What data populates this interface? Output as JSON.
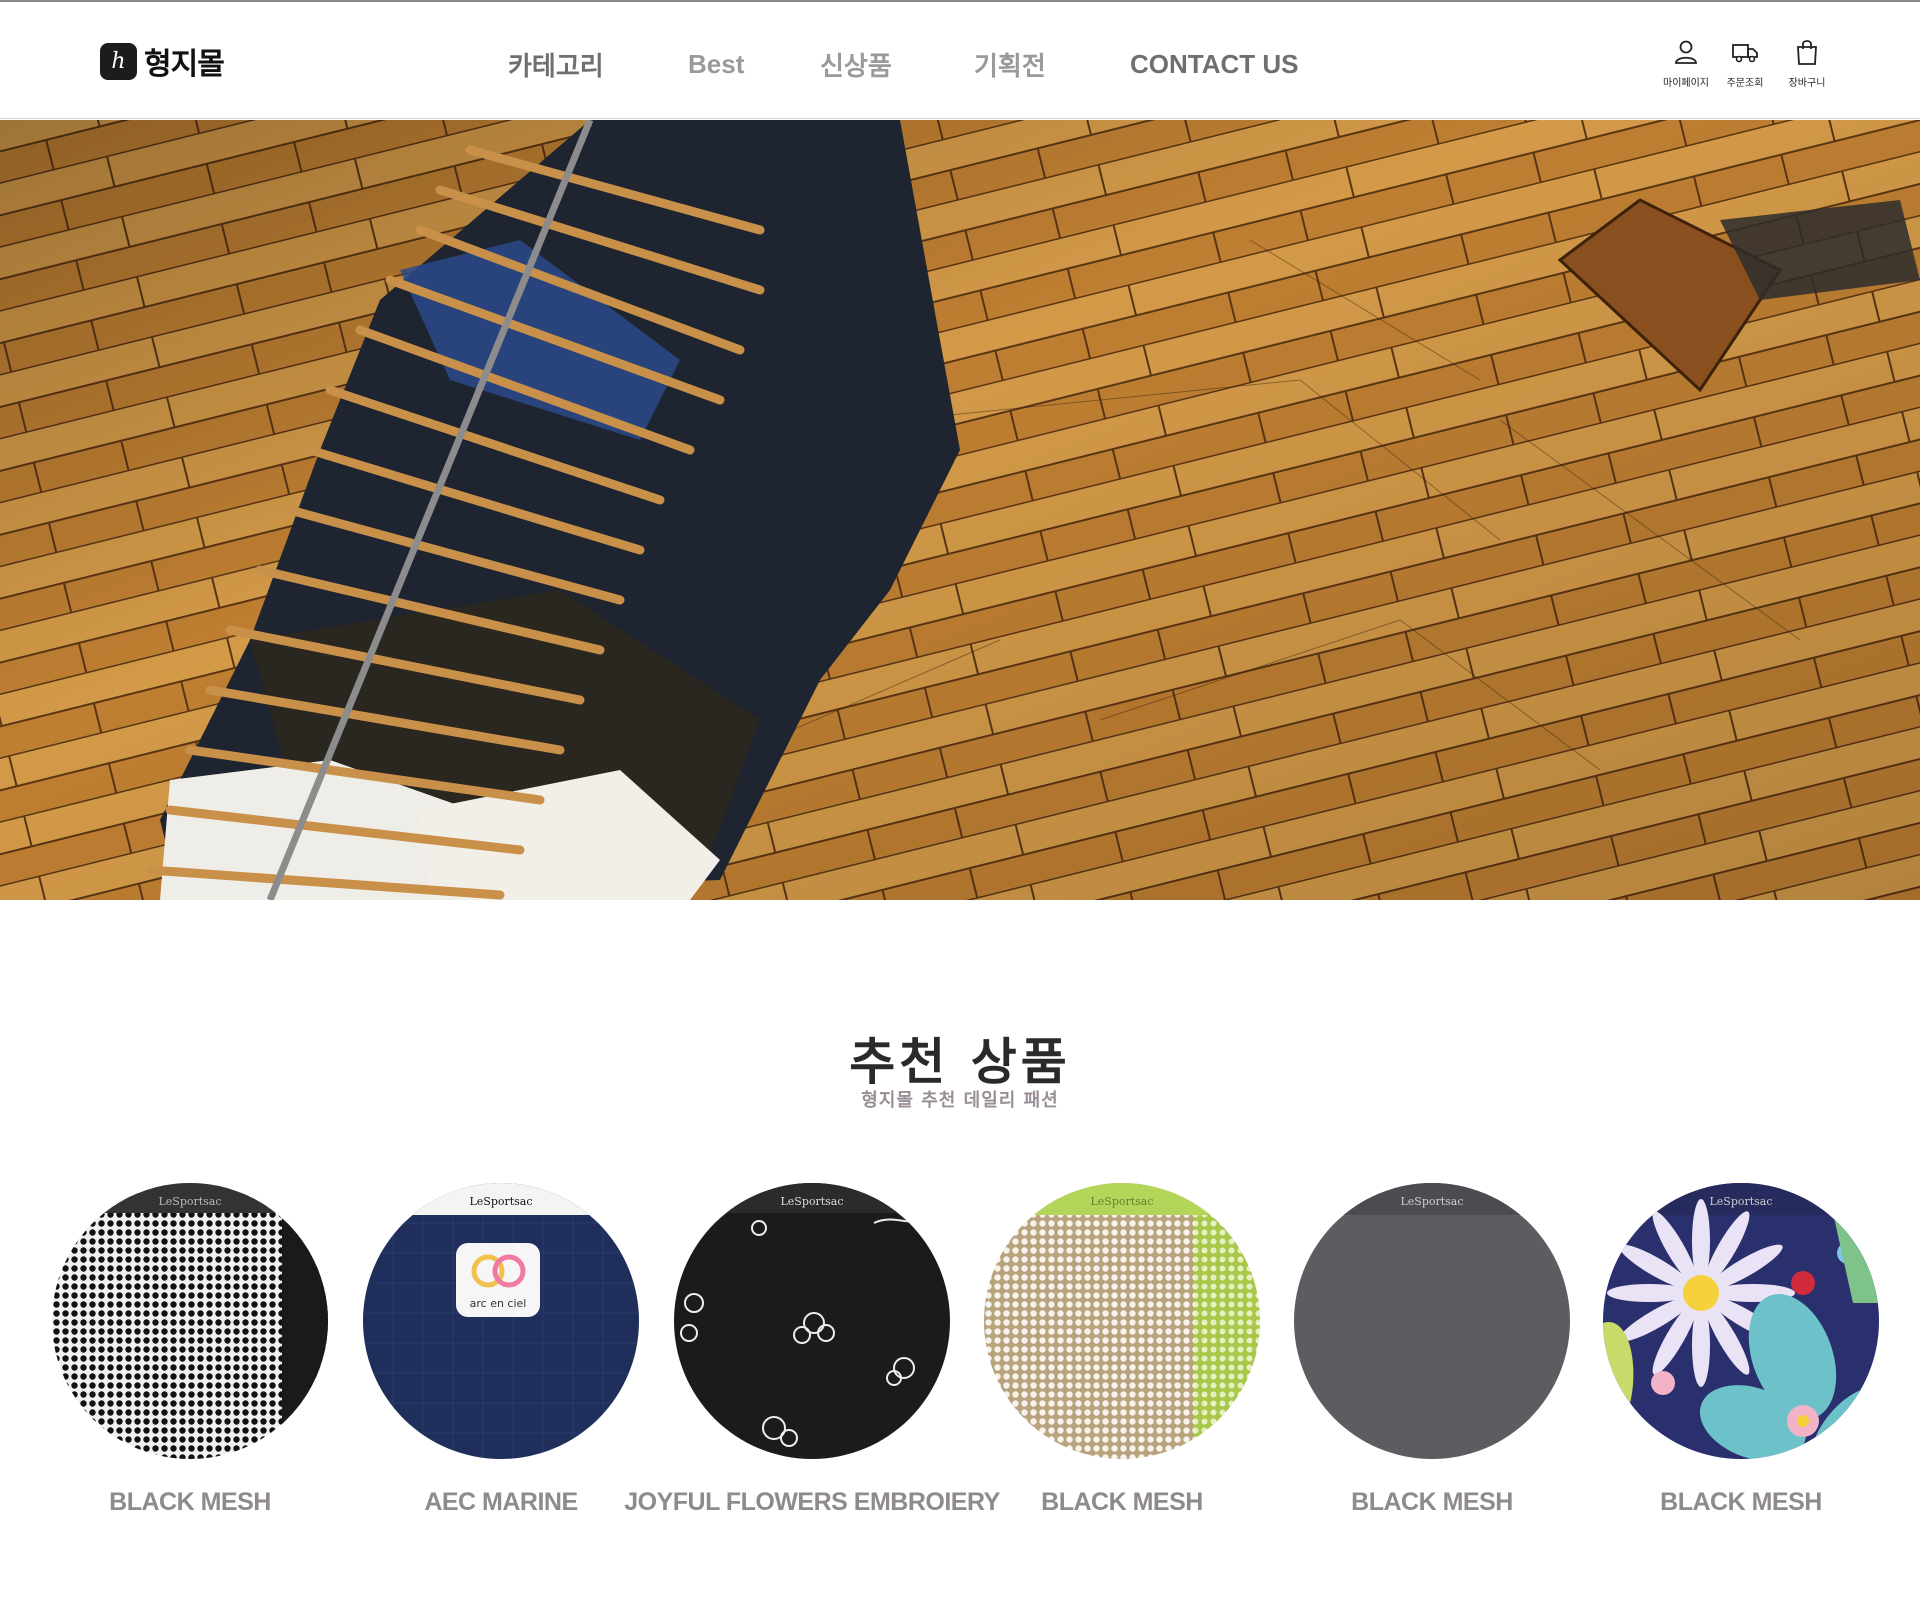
{
  "header": {
    "logo_mark": "h",
    "logo_text": "형지몰",
    "nav": [
      "카테고리",
      "Best",
      "신상품",
      "기획전",
      "CONTACT US"
    ],
    "utilities": [
      {
        "label": "마이페이지",
        "icon": "user-icon"
      },
      {
        "label": "주문조회",
        "icon": "truck-icon"
      },
      {
        "label": "장바구니",
        "icon": "shopping-bag-icon"
      }
    ]
  },
  "hero": {
    "image": "clothes-rack-on-wooden-floor"
  },
  "recommended": {
    "title": "추천 상품",
    "subtitle": "형지몰 추천 데일리 패션",
    "products": [
      {
        "name": "BLACK MESH",
        "brand": "LeSportsac",
        "swatch": "black-mesh"
      },
      {
        "name": "AEC MARINE",
        "brand": "LeSportsac",
        "swatch": "navy-arc-en-ciel",
        "badge": "arc en ciel"
      },
      {
        "name": "JOYFUL FLOWERS EMBROIERY",
        "brand": "LeSportsac",
        "swatch": "black-floral-embroidery"
      },
      {
        "name": "BLACK MESH",
        "brand": "LeSportsac",
        "swatch": "beige-lime-mesh"
      },
      {
        "name": "BLACK MESH",
        "brand": "LeSportsac",
        "swatch": "grey-nylon"
      },
      {
        "name": "BLACK MESH",
        "brand": "LeSportsac",
        "swatch": "navy-floral-print"
      }
    ]
  },
  "colors": {
    "nav_text": "#9a9a9a",
    "product_name": "#8f8a8e",
    "subtitle": "#9a8e96",
    "wood": "#c98c3c"
  }
}
